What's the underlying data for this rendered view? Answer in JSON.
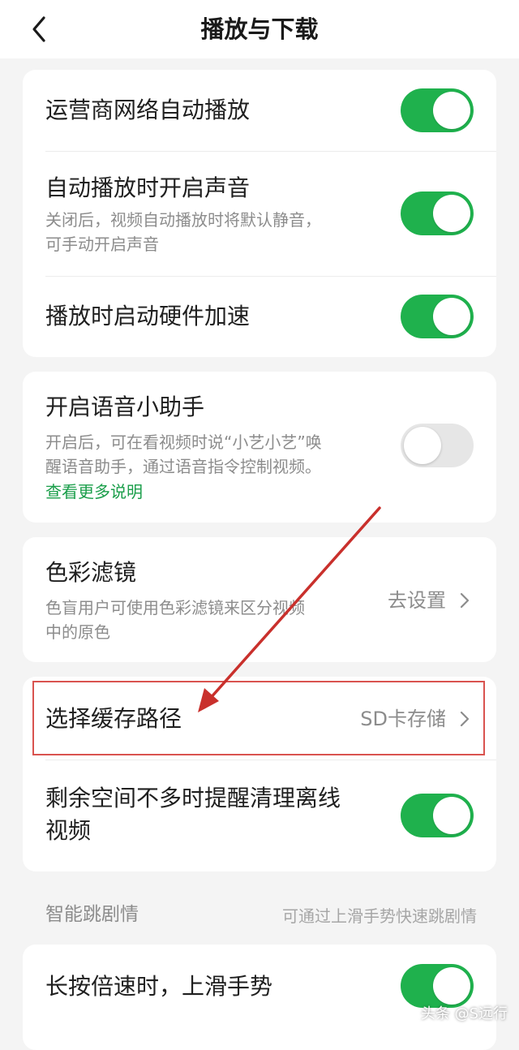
{
  "header": {
    "title": "播放与下载",
    "back_icon": "chevron-left-icon"
  },
  "colors": {
    "accent_green": "#1fb14d",
    "link_green": "#1a9e4a",
    "annotation_red": "#d9534f"
  },
  "card1": {
    "items": [
      {
        "title": "运营商网络自动播放",
        "toggle": "on"
      },
      {
        "title": "自动播放时开启声音",
        "subtitle_line1": "关闭后，视频自动播放时将默认静音，",
        "subtitle_line2": "可手动开启声音",
        "toggle": "on"
      },
      {
        "title": "播放时启动硬件加速",
        "toggle": "on"
      }
    ]
  },
  "card2": {
    "title": "开启语音小助手",
    "subtitle_line1": "开启后，可在看视频时说“小艺小艺”唤",
    "subtitle_line2": "醒语音助手，通过语音指令控制视频。",
    "link": "查看更多说明",
    "toggle": "off"
  },
  "card3": {
    "title": "色彩滤镜",
    "subtitle_line1": "色盲用户可使用色彩滤镜来区分视频",
    "subtitle_line2": "中的原色",
    "value": "去设置"
  },
  "card4": {
    "cache": {
      "title": "选择缓存路径",
      "value": "SD卡存储"
    },
    "reminder": {
      "title_line1": "剩余空间不多时提醒清理离线",
      "title_line2": "视频",
      "toggle": "on"
    }
  },
  "section": {
    "label": "智能跳剧情",
    "hint": "可通过上滑手势快速跳剧情"
  },
  "card5": {
    "title": "长按倍速时，上滑手势",
    "toggle": "on"
  },
  "watermark": "头条 @S远行"
}
